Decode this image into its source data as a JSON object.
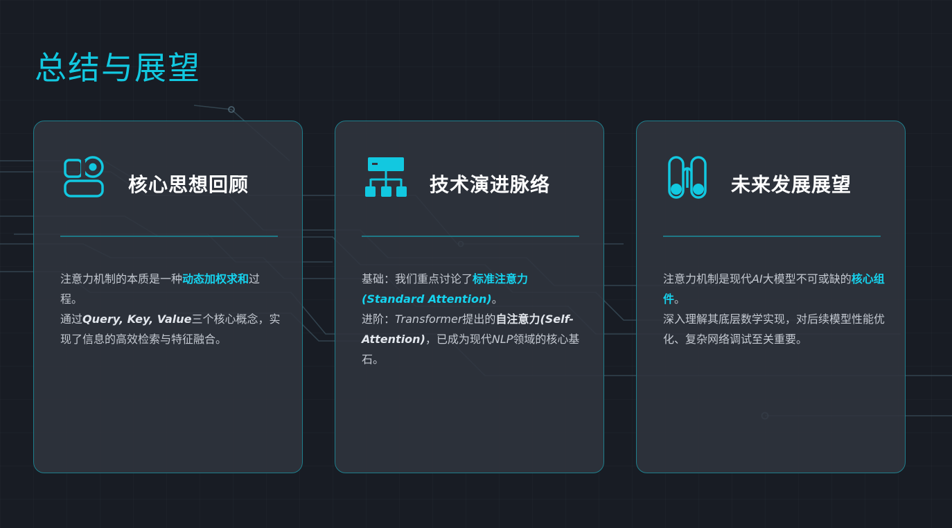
{
  "page": {
    "title": "总结与展望"
  },
  "cards": [
    {
      "icon": "toggle-cards-icon",
      "title": "核心思想回顾",
      "p1_a": "注意力机制的本质是一种",
      "p1_hl": "动态加权求和",
      "p1_b": "过程。",
      "p2_a": "通过",
      "p2_em": "Query, Key, Value",
      "p2_b": "三个核心概念，实现了信息的高效检索与特征融合。"
    },
    {
      "icon": "hierarchy-icon",
      "title": "技术演进脉络",
      "p1_a": "基础：我们重点讨论了",
      "p1_hl": "标准注意力",
      "p1_hl_en": "(Standard Attention)",
      "p1_b": "。",
      "p2_a": "进阶：",
      "p2_em": "Transformer",
      "p2_b": "提出的",
      "p2_strong": "自注意力",
      "p2_em2": "(Self-Attention)",
      "p2_c": "，已成为现代",
      "p2_em3": "NLP",
      "p2_d": "领域的核心基石。"
    },
    {
      "icon": "columns-icon",
      "title": "未来发展展望",
      "p1_a": "注意力机制是现代",
      "p1_em": "AI",
      "p1_b": "大模型不可或缺的",
      "p1_hl": "核心组件",
      "p1_c": "。",
      "p2": "深入理解其底层数学实现，对后续模型性能优化、复杂网络调试至关重要。"
    }
  ],
  "colors": {
    "background": "#181c24",
    "accent": "#12c8e0",
    "card_border": "#1f7f8d",
    "card_fill": "#30343e",
    "body_text": "#c4c9d1"
  }
}
